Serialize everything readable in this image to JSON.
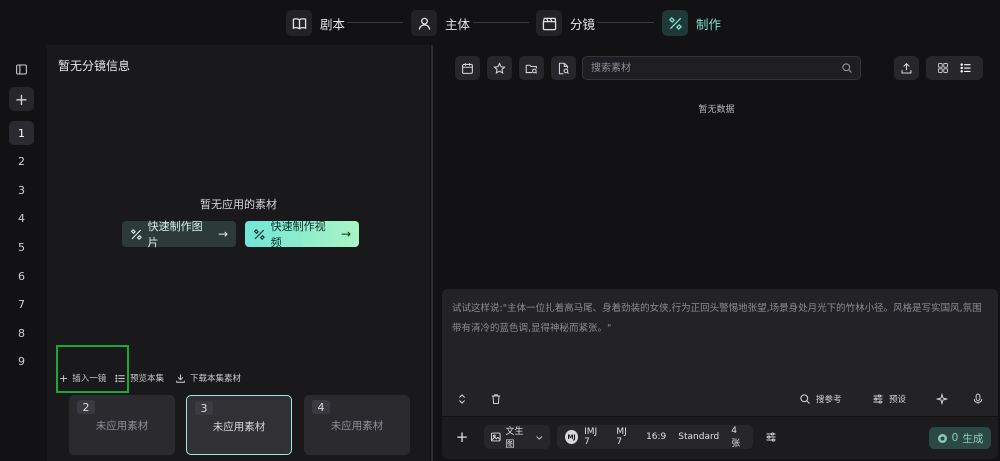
{
  "steps": [
    {
      "label": "剧本",
      "icon": "book-icon"
    },
    {
      "label": "主体",
      "icon": "user-icon"
    },
    {
      "label": "分镜",
      "icon": "clapperboard-icon"
    },
    {
      "label": "制作",
      "icon": "magic-tools-icon",
      "active": true
    }
  ],
  "rail": {
    "shot_numbers": [
      "1",
      "2",
      "3",
      "4",
      "5",
      "6",
      "7",
      "8",
      "9"
    ],
    "active_index": 0,
    "add_label": "+"
  },
  "left_panel": {
    "title": "暂无分镜信息",
    "empty_label": "暂无应用的素材",
    "quick_image_label": "快速制作图片",
    "quick_video_label": "快速制作视频",
    "arrow": "→",
    "insert_label": "插入一镜",
    "preview_label": "预览本集",
    "download_label": "下载本集素材",
    "shots": [
      {
        "num": "2",
        "text": "未应用素材"
      },
      {
        "num": "3",
        "text": "未应用素材",
        "active": true
      },
      {
        "num": "4",
        "text": "未应用素材"
      }
    ]
  },
  "right_panel": {
    "search_placeholder": "搜索素材",
    "no_data": "暂无数据",
    "prompt_placeholder": "试试这样说:\"主体一位扎着高马尾、身着劲装的女侠,行为正回头警惕地张望,场景身处月光下的竹林小径。风格是写实国风,氛围带有清冷的蓝色调,显得神秘而紧张。\"",
    "search_ref_label": "搜参考",
    "preset_label": "预设",
    "mode_label": "文生图",
    "model_badge": "MJ",
    "model_tags": [
      "IMJ 7",
      "MJ 7",
      "16:9",
      "Standard",
      "4张"
    ],
    "generate_cost": "0",
    "generate_label": "生成"
  },
  "colors": {
    "accent": "#7fe0cf",
    "highlight_box": "#1aa83a",
    "bg": "#121214"
  }
}
